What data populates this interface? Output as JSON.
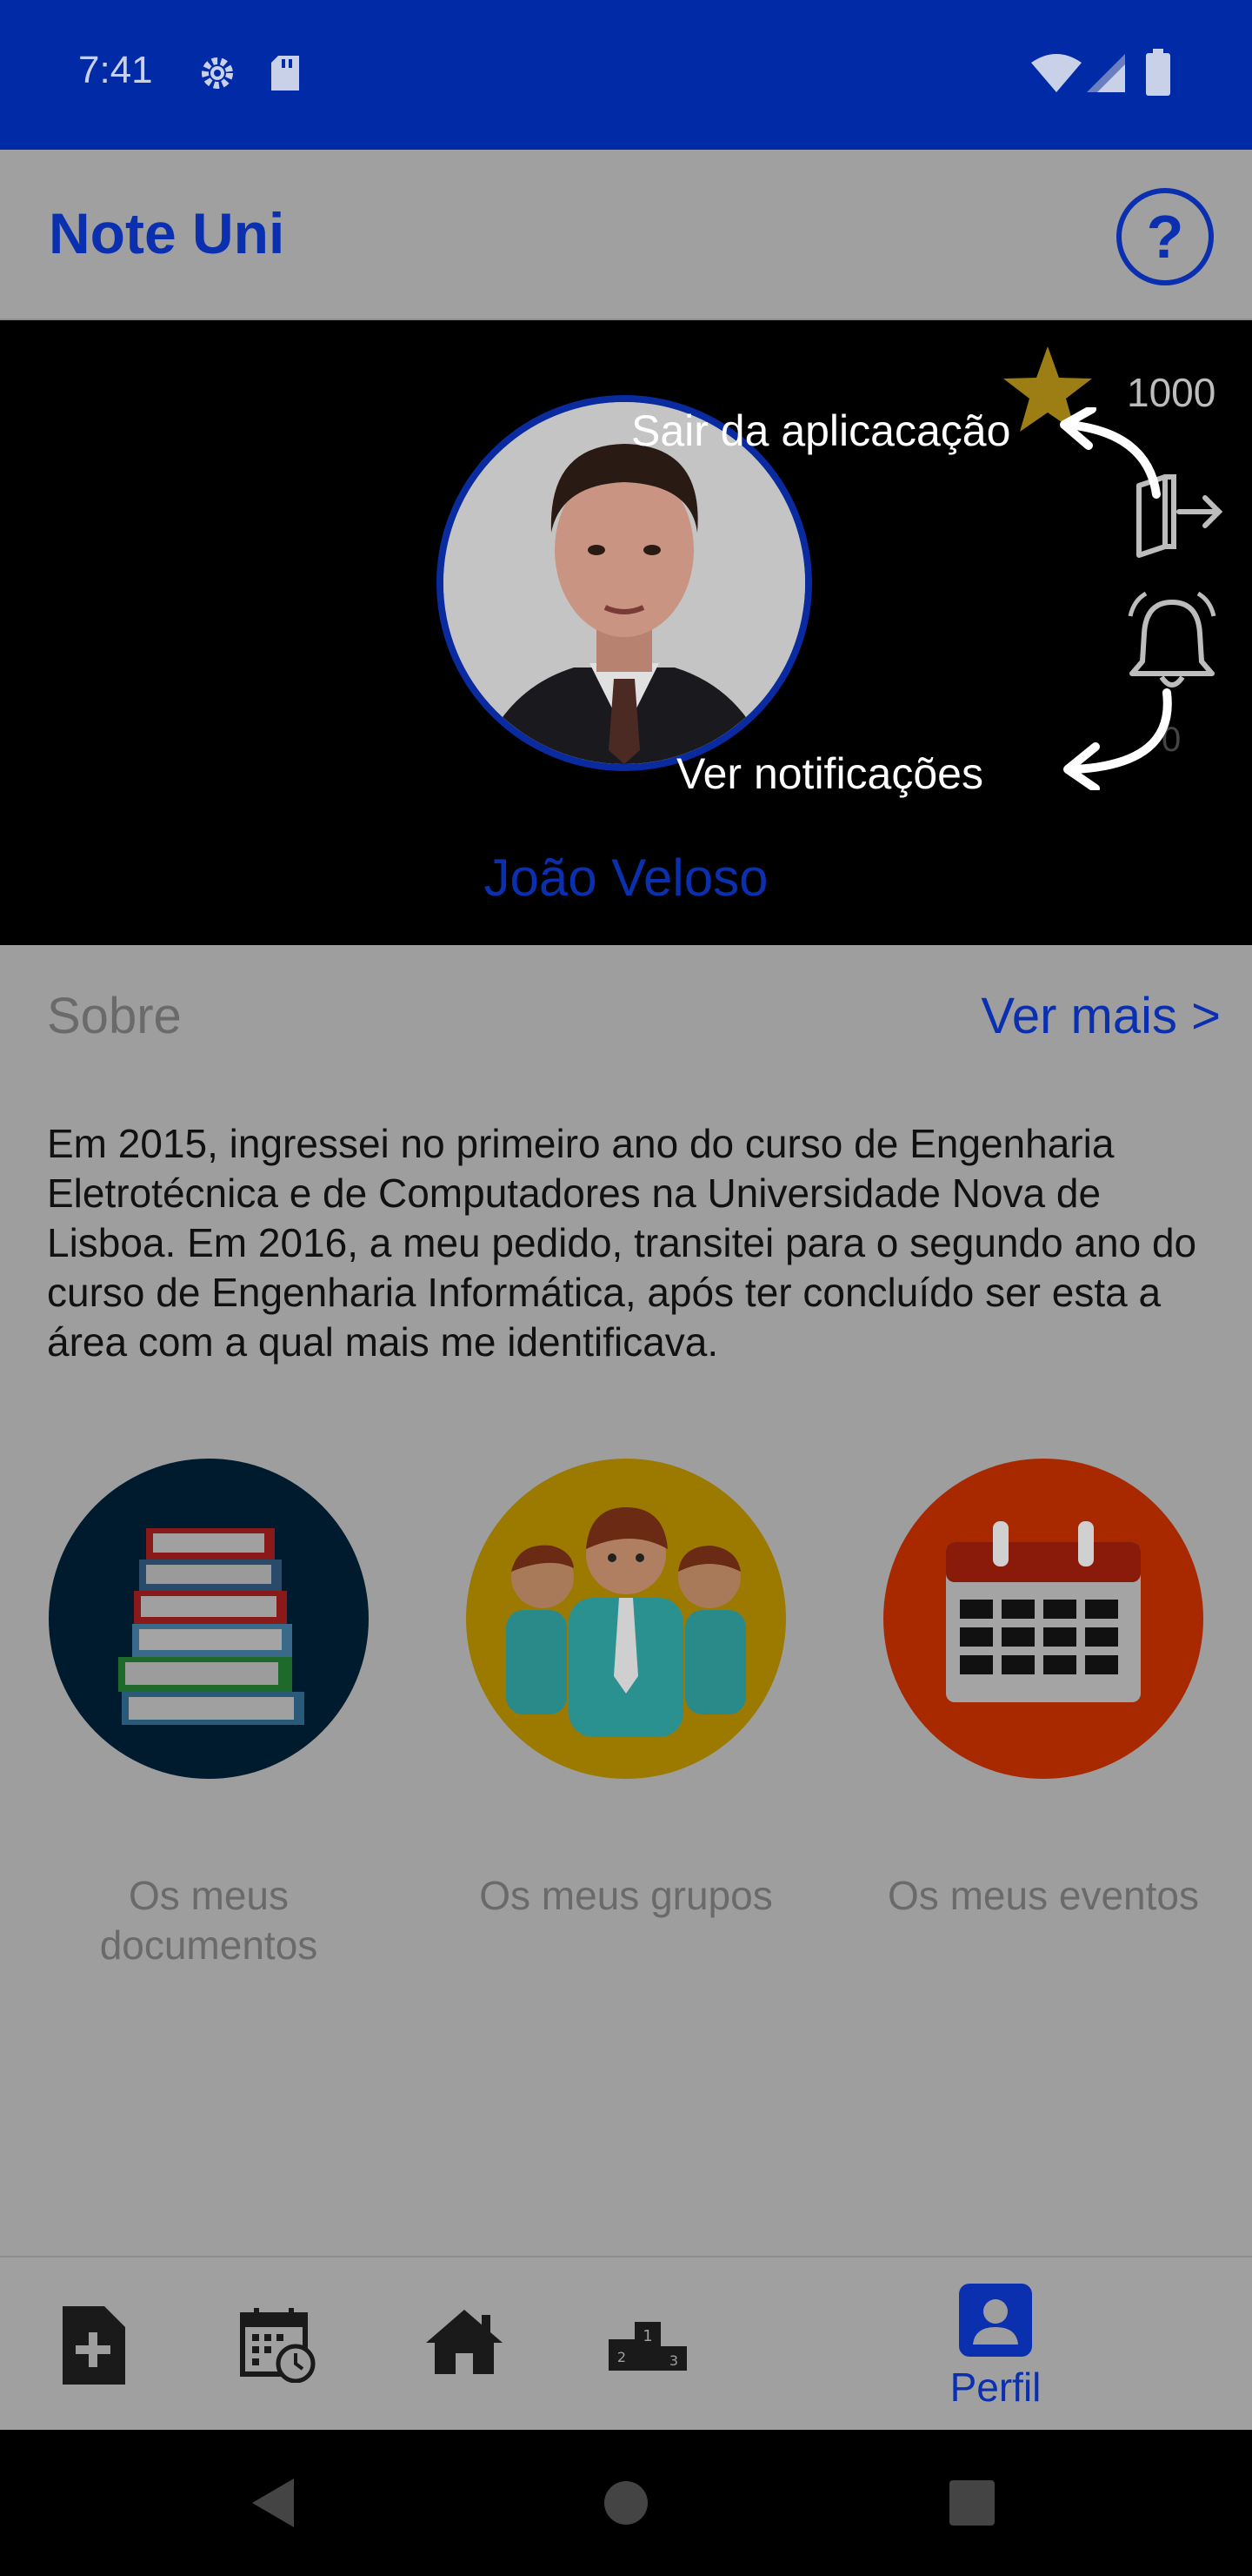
{
  "status_bar": {
    "time": "7:41",
    "icons": [
      "gear-icon",
      "sd-card-icon",
      "wifi-icon",
      "signal-icon",
      "battery-icon"
    ]
  },
  "app_bar": {
    "title": "Note Uni",
    "help_icon": "question-circle-icon"
  },
  "profile": {
    "name": "João Veloso",
    "points": "1000",
    "notification_count": "0",
    "hints": {
      "exit": "Sair da aplicacação",
      "notifications": "Ver notificações"
    }
  },
  "about": {
    "title": "Sobre",
    "more_link": "Ver mais >",
    "text": "Em 2015, ingressei no primeiro ano do curso de Engenharia Eletrotécnica e de Computadores na Universidade Nova de Lisboa. Em 2016, a meu pedido, transitei para o segundo ano do curso de Engenharia Informática, após ter concluído ser esta a área com a qual mais me identificava."
  },
  "shortcuts": [
    {
      "label": "Os meus documentos",
      "icon": "books-icon",
      "color": "#001a2e"
    },
    {
      "label": "Os meus grupos",
      "icon": "group-people-icon",
      "color": "#9c7a00"
    },
    {
      "label": "Os meus eventos",
      "icon": "calendar-icon",
      "color": "#a82800"
    }
  ],
  "bottom_nav": {
    "items": [
      {
        "icon": "add-document-icon"
      },
      {
        "icon": "calendar-clock-icon"
      },
      {
        "icon": "home-icon"
      },
      {
        "icon": "podium-icon"
      },
      {
        "icon": "profile-icon",
        "label": "Perfil",
        "active": true
      }
    ]
  },
  "colors": {
    "primary": "#0a30b0",
    "status_bar": "#002aa6"
  }
}
